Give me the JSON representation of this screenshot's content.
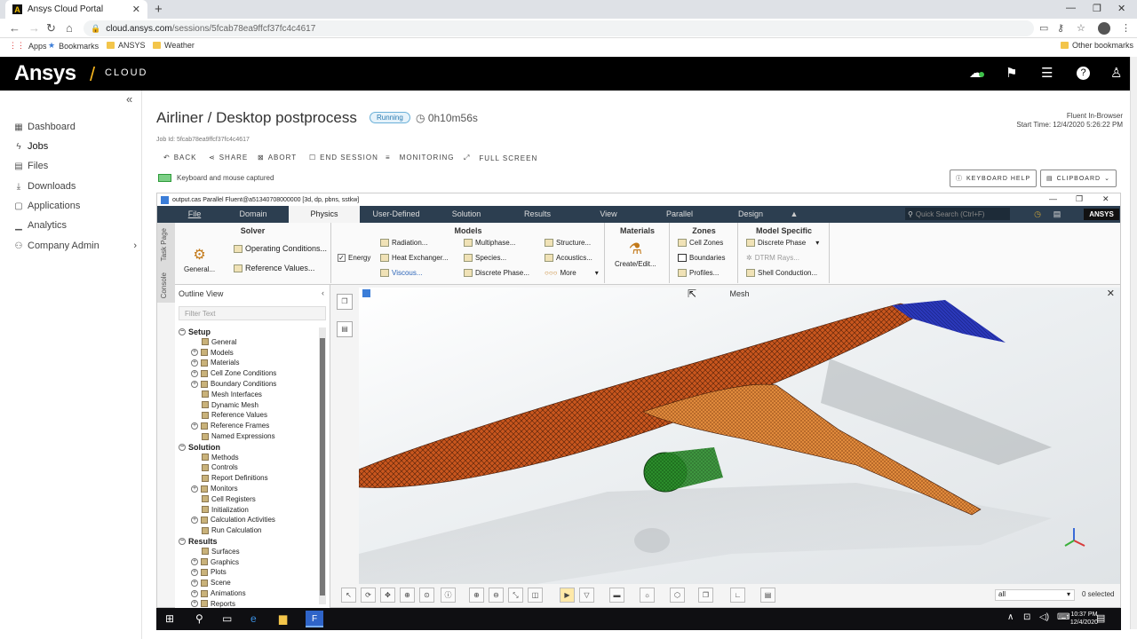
{
  "browser": {
    "tab_title": "Ansys Cloud Portal",
    "tab_icon": "A",
    "url_host": "cloud.ansys.com",
    "url_path": "/sessions/5fcab78ea9ffcf37fc4c4617",
    "bookmarks": [
      {
        "label": "Apps",
        "icon": "apps-icon"
      },
      {
        "label": "Bookmarks",
        "icon": "star-icon"
      },
      {
        "label": "ANSYS",
        "icon": "folder-icon"
      },
      {
        "label": "Weather",
        "icon": "folder-icon"
      }
    ],
    "other_bookmarks": "Other bookmarks"
  },
  "header": {
    "logo": "Ansys",
    "slash": "/",
    "product": "CLOUD",
    "icons": [
      "cloud-status-icon",
      "flag-icon",
      "chat-icon",
      "help-icon",
      "user-icon"
    ]
  },
  "sidebar": {
    "collapse": "«",
    "items": [
      {
        "label": "Dashboard",
        "icon": "dashboard-icon",
        "active": false
      },
      {
        "label": "Jobs",
        "icon": "lightning-icon",
        "active": true
      },
      {
        "label": "Files",
        "icon": "files-icon",
        "active": false
      },
      {
        "label": "Downloads",
        "icon": "download-icon",
        "active": false
      },
      {
        "label": "Applications",
        "icon": "applications-icon",
        "active": false
      },
      {
        "label": "Analytics",
        "icon": "analytics-icon",
        "active": false
      },
      {
        "label": "Company Admin",
        "icon": "admin-icon",
        "active": false
      }
    ]
  },
  "job": {
    "title": "Airliner / Desktop postprocess",
    "status": "Running",
    "elapsed": "0h10m56s",
    "job_id": "Job Id: 5fcab78ea9ffcf37fc4c4617",
    "app": "Fluent In-Browser",
    "start_time": "Start Time: 12/4/2020 5:26:22 PM",
    "actions": [
      "BACK",
      "SHARE",
      "ABORT",
      "END SESSION",
      "MONITORING",
      "FULL SCREEN"
    ],
    "keyboard_status": "Keyboard and mouse captured",
    "keyboard_help": "KEYBOARD HELP",
    "clipboard": "CLIPBOARD"
  },
  "fluent": {
    "window_title": "output.cas Parallel Fluent@a51340708000000  [3d, dp, pbns, sstkw]",
    "menu": [
      "File",
      "Domain",
      "Physics",
      "User-Defined",
      "Solution",
      "Results",
      "View",
      "Parallel",
      "Design"
    ],
    "active_menu": "Physics",
    "quick_search": "Quick Search (Ctrl+F)",
    "brand": "ANSYS",
    "side_tabs": [
      "Task Page",
      "Console"
    ],
    "ribbon": {
      "solver": {
        "title": "Solver",
        "items": [
          "General...",
          "Operating Conditions...",
          "Reference Values..."
        ]
      },
      "models": {
        "title": "Models",
        "energy": "Energy",
        "items": [
          "Radiation...",
          "Heat Exchanger...",
          "Viscous...",
          "Multiphase...",
          "Species...",
          "Discrete Phase...",
          "Structure...",
          "Acoustics...",
          "More"
        ]
      },
      "materials": {
        "title": "Materials",
        "items": [
          "Create/Edit..."
        ]
      },
      "zones": {
        "title": "Zones",
        "items": [
          "Cell Zones",
          "Boundaries",
          "Profiles..."
        ]
      },
      "model_specific": {
        "title": "Model Specific",
        "items": [
          "Discrete Phase",
          "DTRM Rays...",
          "Shell Conduction..."
        ]
      }
    },
    "outline": {
      "title": "Outline View",
      "filter_placeholder": "Filter Text",
      "tree": [
        {
          "label": "Setup",
          "section": true
        },
        {
          "label": "General"
        },
        {
          "label": "Models",
          "expand": true
        },
        {
          "label": "Materials",
          "expand": true
        },
        {
          "label": "Cell Zone Conditions",
          "expand": true
        },
        {
          "label": "Boundary Conditions",
          "expand": true
        },
        {
          "label": "Mesh Interfaces"
        },
        {
          "label": "Dynamic Mesh"
        },
        {
          "label": "Reference Values"
        },
        {
          "label": "Reference Frames",
          "expand": true
        },
        {
          "label": "Named Expressions"
        },
        {
          "label": "Solution",
          "section": true
        },
        {
          "label": "Methods"
        },
        {
          "label": "Controls"
        },
        {
          "label": "Report Definitions"
        },
        {
          "label": "Monitors",
          "expand": true
        },
        {
          "label": "Cell Registers"
        },
        {
          "label": "Initialization"
        },
        {
          "label": "Calculation Activities",
          "expand": true
        },
        {
          "label": "Run Calculation"
        },
        {
          "label": "Results",
          "section": true
        },
        {
          "label": "Surfaces"
        },
        {
          "label": "Graphics",
          "expand": true
        },
        {
          "label": "Plots",
          "expand": true
        },
        {
          "label": "Scene",
          "expand": true
        },
        {
          "label": "Animations",
          "expand": true
        },
        {
          "label": "Reports",
          "expand": true
        }
      ]
    },
    "view_title": "Mesh",
    "selection_filter": "all",
    "selected": "0 selected"
  },
  "taskbar": {
    "time": "10:37 PM",
    "date": "12/4/2020"
  },
  "colors": {
    "header_bg": "#000000",
    "logo_accent": "#f6b51e",
    "menubar_bg": "#2c3e50",
    "fuselage_mesh": "#c8561e",
    "wing_mesh": "#e08a3c",
    "tail_mesh": "#2a37b8",
    "engine_mesh": "#2b8c2b"
  }
}
